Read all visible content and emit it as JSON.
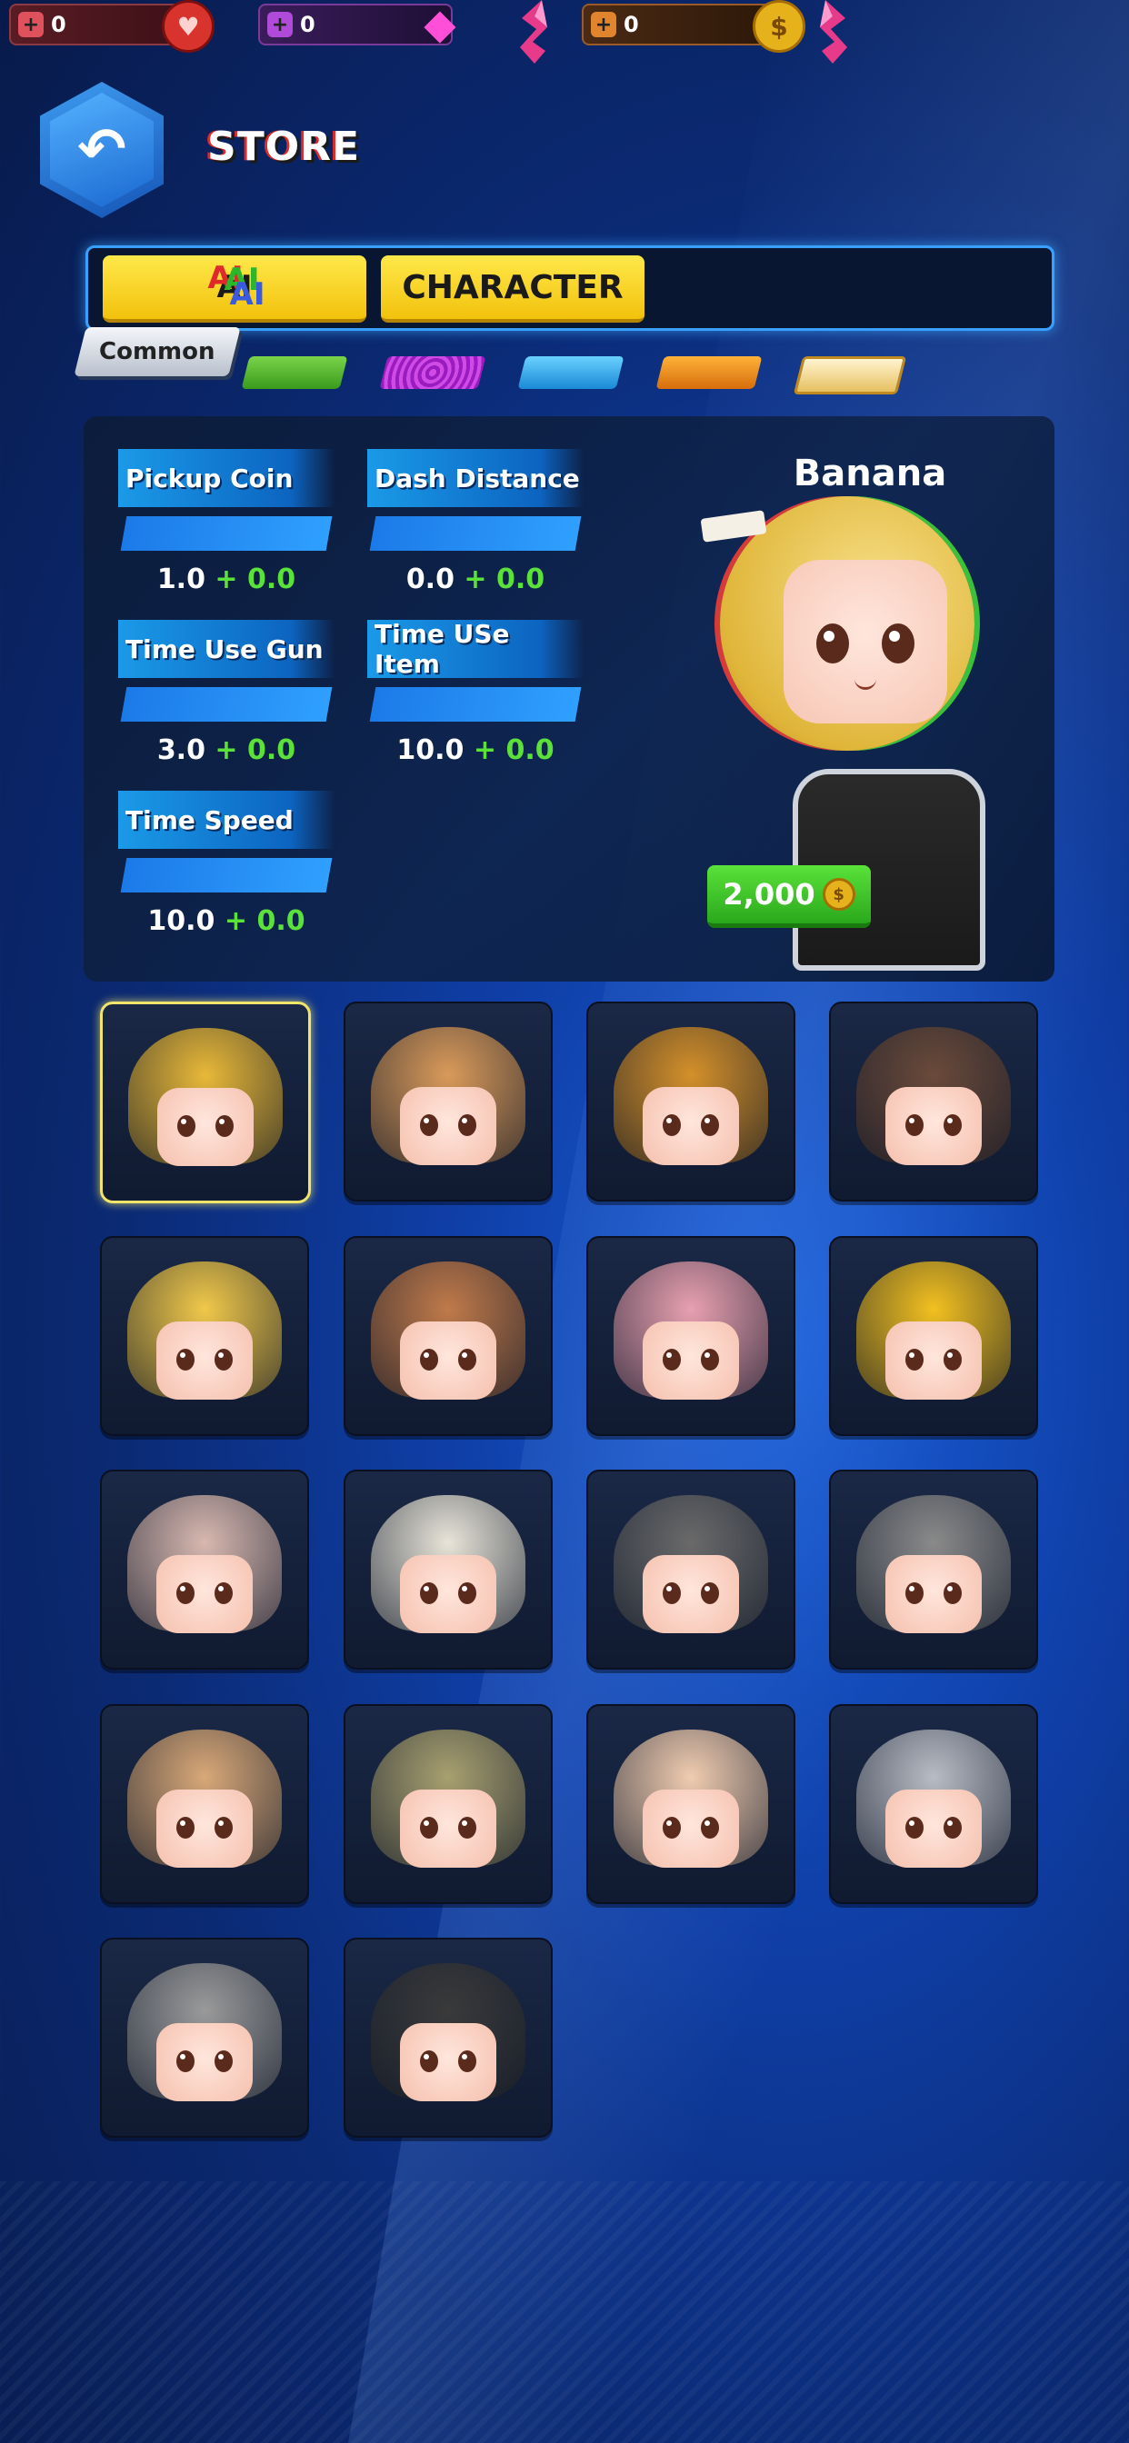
{
  "resources": [
    {
      "name": "red-gem",
      "value": "0",
      "color": "#d9332e",
      "icon": "heart-gem-icon"
    },
    {
      "name": "purple-gem",
      "value": "0",
      "color": "#ff4fd8",
      "icon": "diamond-icon"
    },
    {
      "name": "coin",
      "value": "0",
      "color": "#e6b21c",
      "icon": "coin-icon"
    }
  ],
  "header": {
    "title": "STORE",
    "back_icon": "back-arrow-icon"
  },
  "tabs": [
    {
      "label": "AI",
      "active": true
    },
    {
      "label": "CHARACTER",
      "active": false
    }
  ],
  "rarity": {
    "selected_label": "Common",
    "chips": [
      "green",
      "purple",
      "blue",
      "orange",
      "gold"
    ]
  },
  "stats": {
    "pickup_coin": {
      "label": "Pickup Coin",
      "base": "1.0",
      "plus": "+",
      "bonus": "0.0"
    },
    "dash_distance": {
      "label": "Dash Distance",
      "base": "0.0",
      "plus": "+",
      "bonus": "0.0"
    },
    "time_use_gun": {
      "label": "Time Use Gun",
      "base": "3.0",
      "plus": "+",
      "bonus": "0.0"
    },
    "time_use_item": {
      "label": "Time USe Item",
      "base": "10.0",
      "plus": "+",
      "bonus": "0.0"
    },
    "time_speed": {
      "label": "Time Speed",
      "base": "10.0",
      "plus": "+",
      "bonus": "0.0"
    }
  },
  "character": {
    "name": "Banana",
    "price": "2,000",
    "price_icon": "coin-icon"
  },
  "grid": [
    {
      "icon": "banana-hat",
      "hat_color": "#e8b838",
      "selected": true
    },
    {
      "icon": "roast-chicken-hat",
      "hat_color": "#d99a5a",
      "selected": false
    },
    {
      "icon": "pie-hat",
      "hat_color": "#d4902a",
      "selected": false
    },
    {
      "icon": "cupcake-hat",
      "hat_color": "#6a4a3a",
      "selected": false
    },
    {
      "icon": "durian-hat",
      "hat_color": "#f0c84a",
      "selected": false
    },
    {
      "icon": "bread-hat",
      "hat_color": "#c07a4a",
      "selected": false
    },
    {
      "icon": "lotus-hat",
      "hat_color": "#e8a0b0",
      "selected": false
    },
    {
      "icon": "fries-hat",
      "hat_color": "#f2c020",
      "selected": false
    },
    {
      "icon": "garlic-hat",
      "hat_color": "#d8b8b0",
      "selected": false
    },
    {
      "icon": "helmet-hat",
      "hat_color": "#e8e4d8",
      "selected": false
    },
    {
      "icon": "cup-hat",
      "hat_color": "#6a6a6a",
      "selected": false
    },
    {
      "icon": "pot-hat",
      "hat_color": "#8a8a8a",
      "selected": false
    },
    {
      "icon": "toast-egg-hat",
      "hat_color": "#d8a878",
      "selected": false
    },
    {
      "icon": "crown-bun-hat",
      "hat_color": "#a8a070",
      "selected": false
    },
    {
      "icon": "onigiri-hat",
      "hat_color": "#f0ccb0",
      "selected": false
    },
    {
      "icon": "kettle-hat",
      "hat_color": "#b8bcc4",
      "selected": false
    },
    {
      "icon": "rice-cooker-hat",
      "hat_color": "#9a9a9a",
      "selected": false
    },
    {
      "icon": "tv-hat",
      "hat_color": "#3a3a3a",
      "selected": false
    }
  ]
}
